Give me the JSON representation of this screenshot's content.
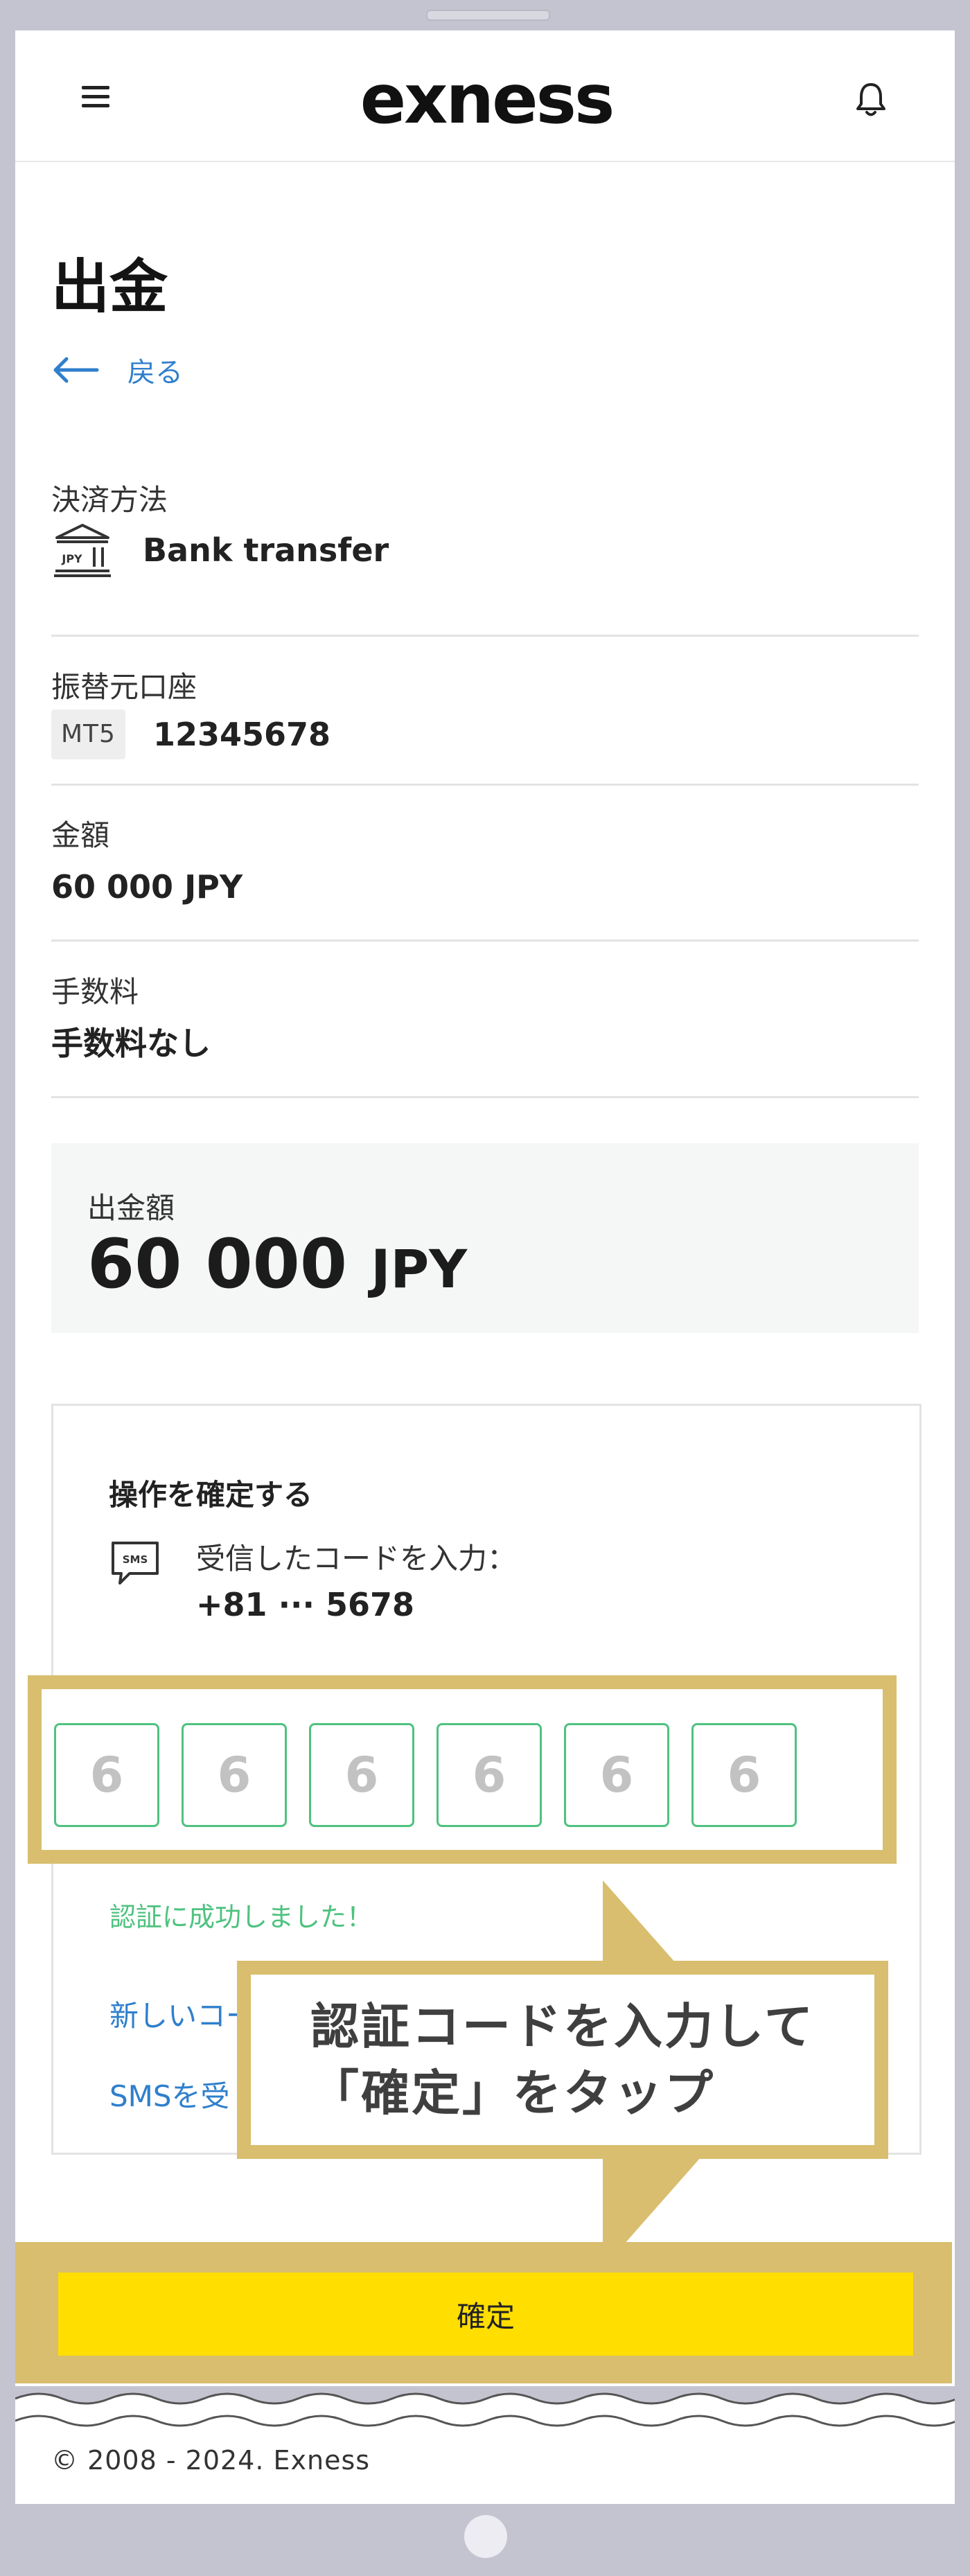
{
  "header": {
    "logo_text": "exness",
    "menu_icon": "hamburger-menu-icon",
    "notification_icon": "bell-icon"
  },
  "page": {
    "title": "出金",
    "back_label": "戻る"
  },
  "fields": {
    "payment_method": {
      "label": "決済方法",
      "value": "Bank transfer",
      "icon": "bank-jpy-icon",
      "icon_text": "JPY"
    },
    "source_account": {
      "label": "振替元口座",
      "badge": "MT5",
      "value": "12345678"
    },
    "amount": {
      "label": "金額",
      "value": "60 000 JPY"
    },
    "fee": {
      "label": "手数料",
      "value": "手数料なし"
    }
  },
  "withdrawal": {
    "label": "出金額",
    "amount": "60 000",
    "currency": "JPY"
  },
  "confirm": {
    "title": "操作を確定する",
    "sms_icon_text": "SMS",
    "instruction": "受信したコードを入力：",
    "phone": "+81 ··· 5678",
    "code_digits": [
      "6",
      "6",
      "6",
      "6",
      "6",
      "6"
    ],
    "success_message": "認証に成功しました！",
    "resend_link": "新しいコー",
    "sms_link": "SMSを受"
  },
  "callout": {
    "text": "認証コードを入力して\n「確定」をタップ"
  },
  "button": {
    "confirm_label": "確定"
  },
  "footer": {
    "copyright": "© 2008 - 2024. Exness"
  },
  "colors": {
    "accent_blue": "#2f7fcc",
    "success_green": "#4ec27f",
    "button_yellow": "#ffde00",
    "highlight_gold": "#d8be6e"
  }
}
